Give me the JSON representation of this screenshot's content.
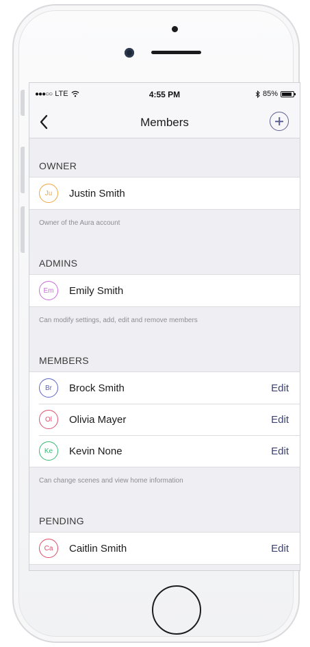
{
  "status_bar": {
    "signal": "●●●○○",
    "carrier": "LTE",
    "time": "4:55 PM",
    "battery_percent": "85%",
    "battery_level": 0.85
  },
  "nav": {
    "title": "Members",
    "back_icon": "chevron-left-icon",
    "add_icon": "plus-circle-icon"
  },
  "sections": {
    "owner": {
      "header": "OWNER",
      "note": "Owner of the Aura account",
      "rows": [
        {
          "initials": "Ju",
          "name": "Justin Smith",
          "color": "#f0a640"
        }
      ]
    },
    "admins": {
      "header": "ADMINS",
      "note": "Can modify settings, add, edit and remove members",
      "rows": [
        {
          "initials": "Em",
          "name": "Emily Smith",
          "color": "#c66bd6"
        }
      ]
    },
    "members": {
      "header": "MEMBERS",
      "note": "Can change scenes and view home information",
      "rows": [
        {
          "initials": "Br",
          "name": "Brock Smith",
          "color": "#5b63c7",
          "action": "Edit"
        },
        {
          "initials": "Ol",
          "name": "Olivia Mayer",
          "color": "#e0506e",
          "action": "Edit"
        },
        {
          "initials": "Ke",
          "name": "Kevin None",
          "color": "#35b872",
          "action": "Edit"
        }
      ]
    },
    "pending": {
      "header": "PENDING",
      "rows": [
        {
          "initials": "Ca",
          "name": "Caitlin Smith",
          "color": "#e04a66",
          "action": "Edit"
        }
      ]
    }
  },
  "colors": {
    "accent": "#3c4170",
    "background": "#efeff3"
  }
}
